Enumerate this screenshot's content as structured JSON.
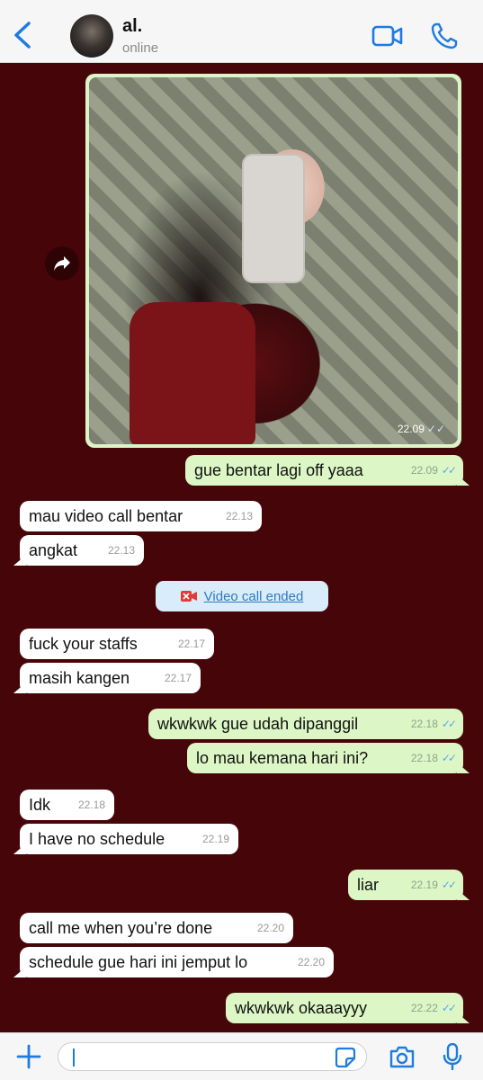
{
  "header": {
    "contact_name": "al.",
    "status": "online"
  },
  "photo_message": {
    "time": "22.09",
    "checks": "✓✓"
  },
  "messages": [
    {
      "text": "gue bentar lagi off yaaa",
      "time": "22.09",
      "dir": "out"
    },
    {
      "text": "mau video call bentar",
      "time": "22.13",
      "dir": "in"
    },
    {
      "text": "angkat",
      "time": "22.13",
      "dir": "in"
    },
    {
      "text": "fuck your staffs",
      "time": "22.17",
      "dir": "in"
    },
    {
      "text": "masih kangen",
      "time": "22.17",
      "dir": "in"
    },
    {
      "text": "wkwkwk gue udah dipanggil",
      "time": "22.18",
      "dir": "out"
    },
    {
      "text": "lo mau kemana hari ini?",
      "time": "22.18",
      "dir": "out"
    },
    {
      "text": "Idk",
      "time": "22.18",
      "dir": "in"
    },
    {
      "text": "I have no schedule",
      "time": "22.19",
      "dir": "in"
    },
    {
      "text": "liar",
      "time": "22.19",
      "dir": "out"
    },
    {
      "text": "call me when you’re done",
      "time": "22.20",
      "dir": "in"
    },
    {
      "text": "schedule gue hari ini jemput lo",
      "time": "22.20",
      "dir": "in"
    },
    {
      "text": "wkwkwk okaaayyy",
      "time": "22.22",
      "dir": "out"
    }
  ],
  "system_message": {
    "label": "Video call ended"
  },
  "checks": "✓✓",
  "composer": {
    "value": ""
  },
  "icons": [
    "back-chevron-icon",
    "video-call-icon",
    "phone-call-icon",
    "forward-icon",
    "missed-video-icon",
    "plus-icon",
    "sticker-icon",
    "camera-icon",
    "microphone-icon"
  ],
  "colors": {
    "accent": "#1e7be0",
    "chat_background": "#460609",
    "outgoing_bubble": "#dcf7c5",
    "incoming_bubble": "#ffffff"
  }
}
